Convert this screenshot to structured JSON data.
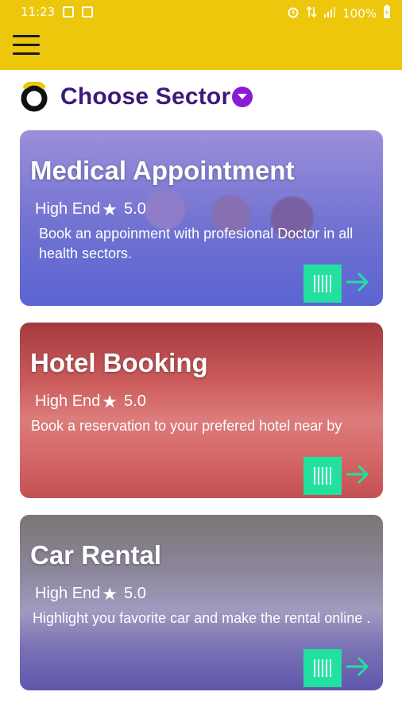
{
  "status_bar": {
    "time": "11:23",
    "battery": "100%"
  },
  "header": {
    "title": "Choose Sector"
  },
  "colors": {
    "brand_yellow": "#ecc70b",
    "title_purple": "#3e1a7a",
    "dropdown_purple": "#8a1cd6",
    "action_green": "#22e0a0"
  },
  "cards": [
    {
      "title": "Medical Appointment",
      "rating_label": "High End",
      "rating_value": "5.0",
      "description": "Book an appoinment with profesional Doctor in all health sectors."
    },
    {
      "title": "Hotel Booking",
      "rating_label": "High End",
      "rating_value": "5.0",
      "description": "Book a reservation to your prefered hotel near by"
    },
    {
      "title": "Car Rental",
      "rating_label": "High End",
      "rating_value": "5.0",
      "description": "Highlight you favorite car and make the rental online ."
    }
  ]
}
